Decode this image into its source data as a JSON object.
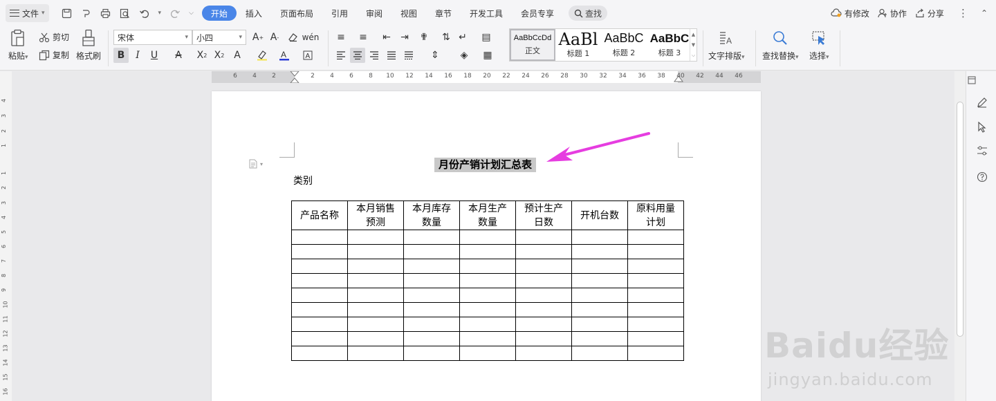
{
  "menubar": {
    "file_label": "文件",
    "tabs": [
      {
        "label": "开始",
        "active": true
      },
      {
        "label": "插入"
      },
      {
        "label": "页面布局"
      },
      {
        "label": "引用"
      },
      {
        "label": "审阅"
      },
      {
        "label": "视图"
      },
      {
        "label": "章节"
      },
      {
        "label": "开发工具"
      },
      {
        "label": "会员专享"
      }
    ],
    "search_label": "查找",
    "right": {
      "modified": "有修改",
      "collab": "协作",
      "share": "分享"
    }
  },
  "ribbon": {
    "clipboard": {
      "paste": "粘贴",
      "cut": "剪切",
      "copy": "复制",
      "format_painter": "格式刷"
    },
    "font": {
      "family": "宋体",
      "size": "小四"
    },
    "styles": [
      {
        "sample": "AaBbCcDd",
        "name": "正文",
        "selected": true
      },
      {
        "sample": "AaBl",
        "name": "标题 1"
      },
      {
        "sample": "AaBbC",
        "name": "标题 2"
      },
      {
        "sample": "AaBbC",
        "name": "标题 3"
      }
    ],
    "text_layout": "文字排版",
    "find_replace": "查找替换",
    "select": "选择"
  },
  "ruler": {
    "h_ticks": [
      "6",
      "4",
      "2",
      "2",
      "4",
      "6",
      "8",
      "10",
      "12",
      "14",
      "16",
      "18",
      "20",
      "22",
      "24",
      "26",
      "28",
      "30",
      "32",
      "34",
      "36",
      "38",
      "40",
      "42",
      "44",
      "46"
    ],
    "v_ticks": [
      "4",
      "3",
      "2",
      "1",
      "1",
      "2",
      "3",
      "4",
      "5",
      "6",
      "7",
      "8",
      "9",
      "10",
      "11",
      "12",
      "13",
      "14",
      "15",
      "16"
    ]
  },
  "document": {
    "title": "月份产销计划汇总表",
    "category": "类别",
    "table": {
      "headers": [
        [
          "产品名称"
        ],
        [
          "本月销售",
          "预测"
        ],
        [
          "本月库存",
          "数量"
        ],
        [
          "本月生产",
          "数量"
        ],
        [
          "预计生产",
          "日数"
        ],
        [
          "开机台数"
        ],
        [
          "原料用量",
          "计划"
        ]
      ],
      "empty_rows": 9
    }
  },
  "watermark": {
    "brand": "Baidu经验",
    "url": "jingyan.baidu.com"
  },
  "colors": {
    "accent": "#4a86e8",
    "arrow": "#e63de0",
    "highlight": "#c8c8c8"
  }
}
